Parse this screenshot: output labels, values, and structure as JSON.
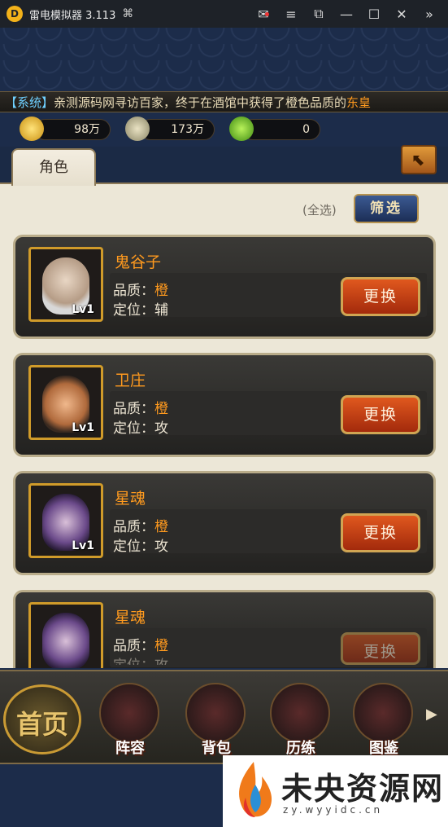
{
  "window": {
    "title": "雷电模拟器 3.113",
    "controls": [
      "mail-icon",
      "menu-icon",
      "screenshot-icon",
      "minimize-icon",
      "maximize-icon",
      "close-icon",
      "sidebar-toggle-icon"
    ]
  },
  "system_message": {
    "prefix": "【系统】",
    "text": "亲测源码网寻访百家，终于在酒馆中获得了橙色品质的",
    "highlight": "东皇"
  },
  "currencies": [
    {
      "icon": "gold-ingot-icon",
      "value": "98万"
    },
    {
      "icon": "copper-coin-icon",
      "value": "173万"
    },
    {
      "icon": "jade-icon",
      "value": "0"
    }
  ],
  "panel": {
    "tab_label": "角色",
    "select_all_label": "(全选)",
    "filter_label": "筛选"
  },
  "characters": [
    {
      "name": "鬼谷子",
      "quality_label": "品质：",
      "quality": "橙",
      "role_label": "定位：",
      "role": "辅",
      "level": "Lv1",
      "change_label": "更换"
    },
    {
      "name": "卫庄",
      "quality_label": "品质：",
      "quality": "橙",
      "role_label": "定位：",
      "role": "攻",
      "level": "Lv1",
      "change_label": "更换"
    },
    {
      "name": "星魂",
      "quality_label": "品质：",
      "quality": "橙",
      "role_label": "定位：",
      "role": "攻",
      "level": "Lv1",
      "change_label": "更换"
    },
    {
      "name": "星魂",
      "quality_label": "品质：",
      "quality": "橙",
      "role_label": "定位：",
      "role": "攻",
      "level": "",
      "change_label": "更换"
    }
  ],
  "bottom_nav": {
    "home_label": "首页",
    "items": [
      {
        "label": "阵容",
        "icon": "abacus-icon"
      },
      {
        "label": "背包",
        "icon": "chest-icon"
      },
      {
        "label": "历练",
        "icon": "crossed-swords-icon"
      },
      {
        "label": "图鉴",
        "icon": "scroll-icon"
      }
    ]
  },
  "watermark": {
    "title": "未央资源网",
    "subtitle": "zy.wyyidc.cn"
  },
  "colors": {
    "quality_orange": "#ff9a1e",
    "button_red": "#c4401a",
    "frame_gold": "#d09b2a",
    "system_blue": "#6fd0ff"
  }
}
